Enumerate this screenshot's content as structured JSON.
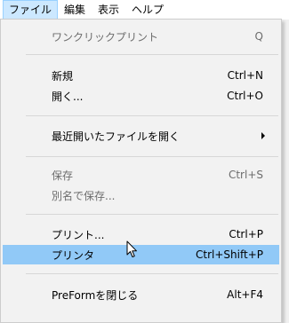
{
  "menubar": {
    "items": [
      {
        "label": "ファイル"
      },
      {
        "label": "編集"
      },
      {
        "label": "表示"
      },
      {
        "label": "ヘルプ"
      }
    ]
  },
  "file_menu": {
    "one_click_print": {
      "label": "ワンクリックプリント",
      "shortcut": "Q"
    },
    "new": {
      "label": "新規",
      "shortcut": "Ctrl+N"
    },
    "open": {
      "label": "開く...",
      "shortcut": "Ctrl+O"
    },
    "recent": {
      "label": "最近開いたファイルを開く",
      "icon": "submenu-arrow-icon"
    },
    "save": {
      "label": "保存",
      "shortcut": "Ctrl+S"
    },
    "save_as": {
      "label": "別名で保存..."
    },
    "print": {
      "label": "プリント...",
      "shortcut": "Ctrl+P"
    },
    "printer": {
      "label": "プリンタ",
      "shortcut": "Ctrl+Shift+P"
    },
    "close": {
      "label": "PreFormを閉じる",
      "shortcut": "Alt+F4"
    }
  },
  "colors": {
    "active_menubar": "#cce8ff",
    "highlight_item": "#91c9f7",
    "disabled_text": "#6d6d6d"
  },
  "cursor": {
    "icon": "mouse-pointer-icon"
  }
}
